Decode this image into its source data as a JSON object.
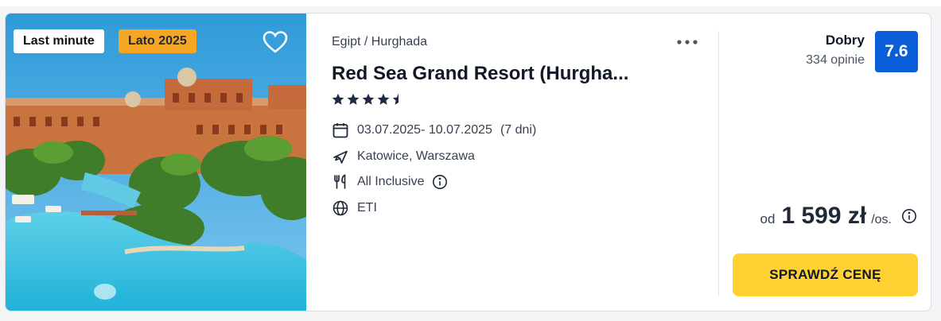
{
  "badges": {
    "last_minute": "Last minute",
    "season": "Lato 2025"
  },
  "hotel": {
    "location": "Egipt / Hurghada",
    "name": "Red Sea Grand Resort (Hurgha...",
    "stars": 4.5,
    "dates": "03.07.2025- 10.07.2025",
    "nights": "(7 dni)",
    "departure": "Katowice, Warszawa",
    "board": "All Inclusive",
    "operator": "ETI"
  },
  "rating": {
    "label": "Dobry",
    "count": "334 opinie",
    "score": "7.6"
  },
  "price": {
    "prefix": "od",
    "value": "1 599 zł",
    "suffix": "/os."
  },
  "cta": {
    "label": "SPRAWDŹ CENĘ"
  },
  "colors": {
    "rating_bg": "#0a5fd8",
    "cta_bg": "#ffd132",
    "season_badge": "#f5a623"
  },
  "icons": [
    "heart-icon",
    "more-dots-icon",
    "star-icon",
    "calendar-icon",
    "plane-icon",
    "cutlery-icon",
    "info-icon",
    "globe-icon"
  ]
}
